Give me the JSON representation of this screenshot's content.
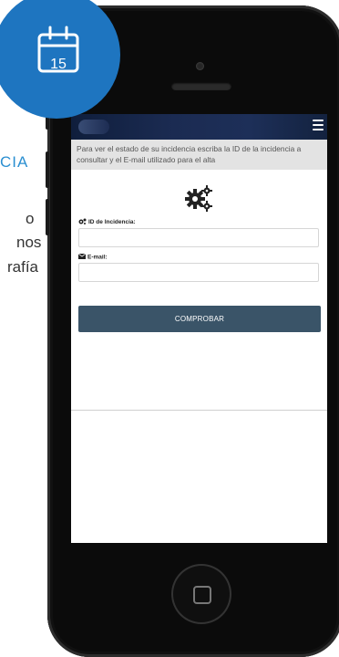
{
  "background_page": {
    "heading_fragment": "CIA",
    "line_fragments": [
      "o",
      "nos",
      "rafía"
    ],
    "accent_color": "#2b8fd1"
  },
  "badge": {
    "icon": "calendar-icon",
    "day": "15",
    "color": "#1e75c0"
  },
  "app": {
    "header_color": "#1b2b52",
    "menu_icon": "hamburger-menu-icon",
    "info_text": "Para ver el estado de su incidencia escriba la ID de la incidencia a consultar y el E-mail utilizado para el alta",
    "gear_icon": "gears-icon",
    "form": {
      "id_label": "ID de Incidencia:",
      "id_icon": "gears-icon",
      "id_value": "",
      "email_label": "E-mail:",
      "email_icon": "envelope-icon",
      "email_value": "",
      "submit_label": "COMPROBAR",
      "submit_color": "#3a5468"
    }
  }
}
